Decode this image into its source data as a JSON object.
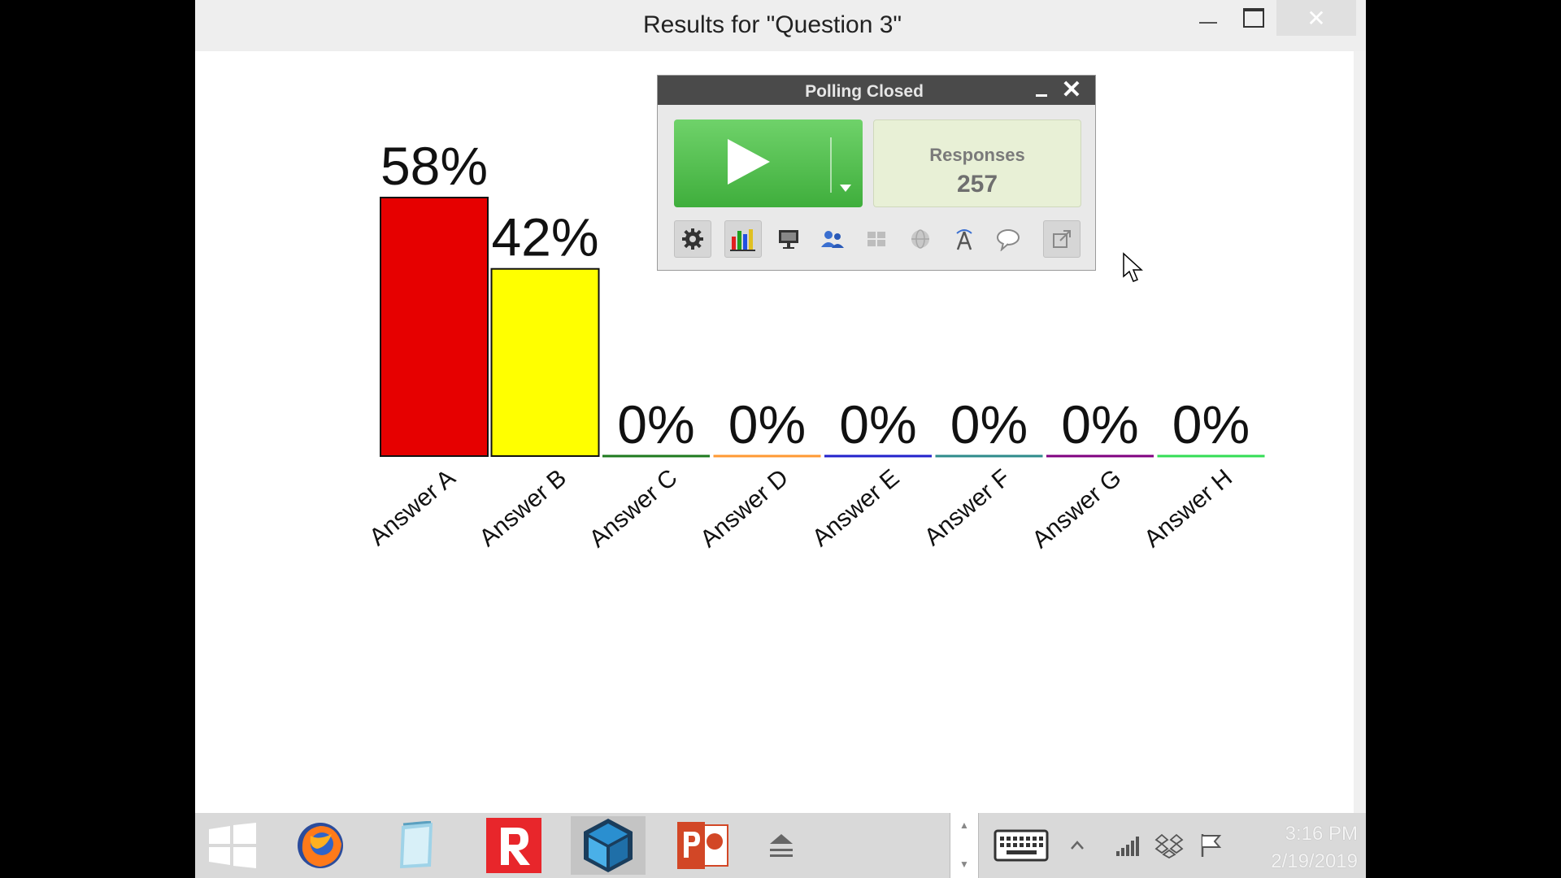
{
  "window": {
    "title": "Results for \"Question 3\"",
    "controls": [
      "minimize",
      "maximize",
      "close"
    ]
  },
  "chart_data": {
    "type": "bar",
    "categories": [
      "Answer A",
      "Answer B",
      "Answer C",
      "Answer D",
      "Answer E",
      "Answer F",
      "Answer G",
      "Answer H"
    ],
    "values": [
      58,
      42,
      0,
      0,
      0,
      0,
      0,
      0
    ],
    "data_labels": [
      "58%",
      "42%",
      "0%",
      "0%",
      "0%",
      "0%",
      "0%",
      "0%"
    ],
    "colors": [
      "#e60000",
      "#ffff00",
      "#1e7a1e",
      "#ff9933",
      "#2222cc",
      "#2e8b8b",
      "#800080",
      "#33dd55"
    ],
    "ylim": [
      0,
      58
    ],
    "title": "",
    "xlabel": "",
    "ylabel": "",
    "grid": false,
    "legend": "none"
  },
  "poll_widget": {
    "title": "Polling Closed",
    "play_icon": "play-icon",
    "responses_label": "Responses",
    "responses_count": "257",
    "toolbar": [
      {
        "name": "settings",
        "icon": "gear-icon"
      },
      {
        "name": "chart",
        "icon": "bar-chart-icon"
      },
      {
        "name": "display",
        "icon": "monitor-icon"
      },
      {
        "name": "participants",
        "icon": "users-icon"
      },
      {
        "name": "compare",
        "icon": "grid-icon"
      },
      {
        "name": "web",
        "icon": "globe-icon"
      },
      {
        "name": "correct",
        "icon": "antenna-icon"
      },
      {
        "name": "comments",
        "icon": "speech-bubble-icon"
      },
      {
        "name": "export",
        "icon": "export-icon"
      }
    ]
  },
  "taskbar": {
    "items": [
      "windows-start",
      "firefox",
      "notepad",
      "response-app",
      "sketchup",
      "powerpoint"
    ],
    "clock_time": "3:16 PM",
    "clock_date": "2/19/2019"
  }
}
